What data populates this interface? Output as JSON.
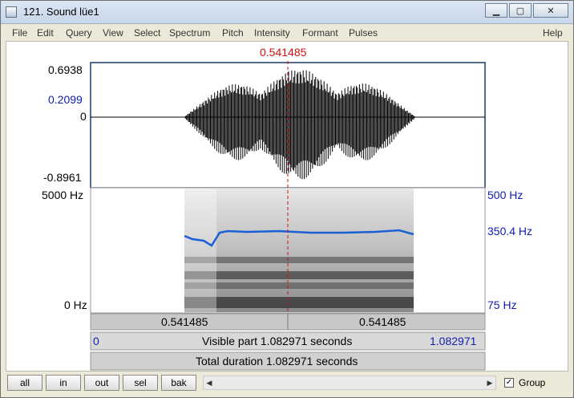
{
  "window": {
    "title": "121. Sound lüe1"
  },
  "menu": [
    "File",
    "Edit",
    "Query",
    "View",
    "Select",
    "Spectrum",
    "Pitch",
    "Intensity",
    "Formant",
    "Pulses",
    "Help"
  ],
  "cursor": {
    "time": "0.541485"
  },
  "waveform": {
    "y_max": "0.6938",
    "y_cursor": "0.2099",
    "y_zero": "0",
    "y_min": "-0.8961"
  },
  "spectrogram": {
    "f_top": "5000 Hz",
    "f_bottom": "0 Hz"
  },
  "pitch": {
    "top": "500 Hz",
    "current": "350.4 Hz",
    "bottom": "75 Hz"
  },
  "time_bars": {
    "left_segment": "0.541485",
    "right_segment": "0.541485",
    "visible_start": "0",
    "visible_label": "Visible part 1.082971 seconds",
    "visible_end": "1.082971",
    "total_label": "Total duration 1.082971 seconds"
  },
  "toolbar": {
    "all": "all",
    "in": "in",
    "out": "out",
    "sel": "sel",
    "bak": "bak",
    "group": "Group",
    "group_checked": true
  },
  "colors": {
    "pitch_line": "#1a5fd6",
    "cursor": "#d01010",
    "frame": "#1a3a6a"
  }
}
